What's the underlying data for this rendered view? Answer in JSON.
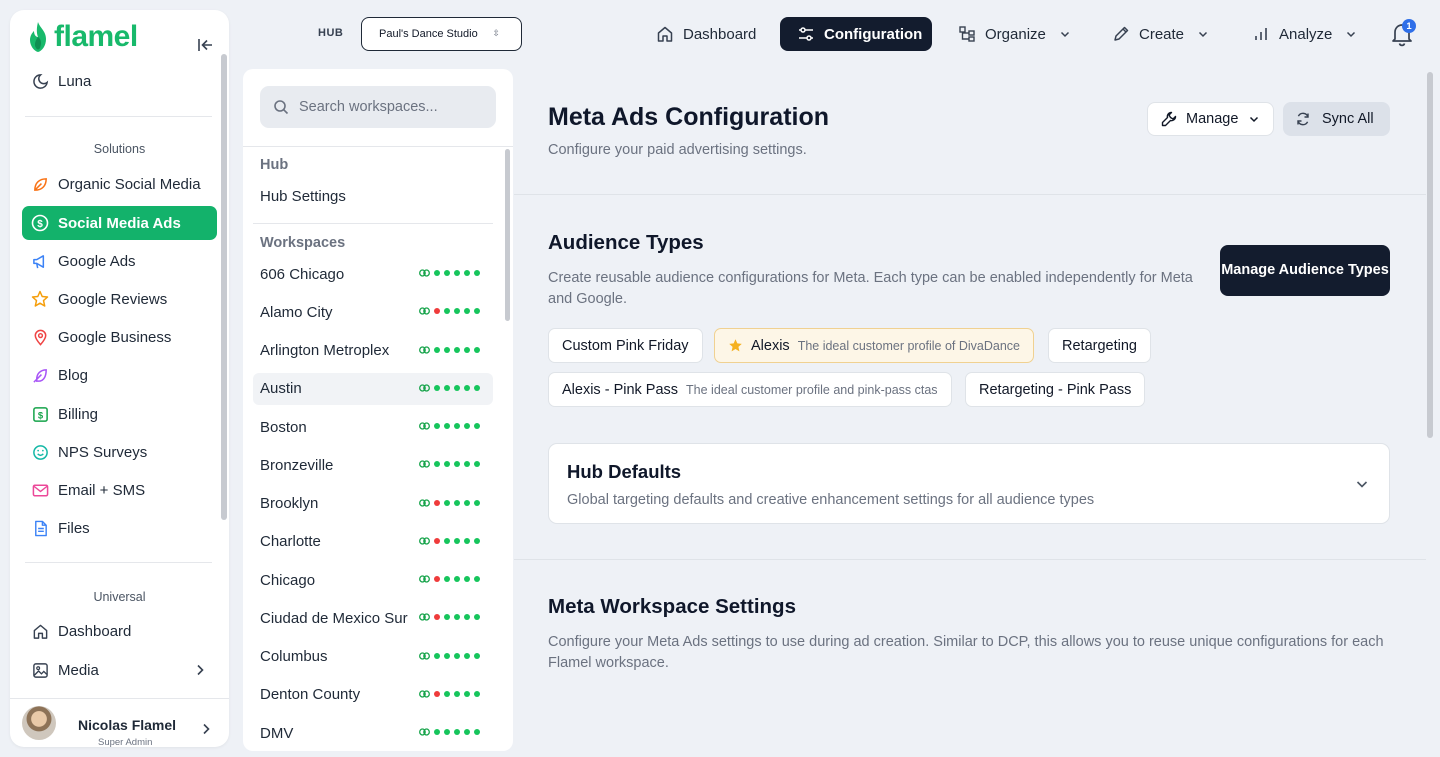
{
  "app": {
    "logo_text": "flamel",
    "brand_color": "#13b26b",
    "dark_color": "#131c2e"
  },
  "sidebar": {
    "top_item": {
      "label": "Luna",
      "icon": "moon-icon"
    },
    "solutions_label": "Solutions",
    "solutions": [
      {
        "label": "Organic Social Media",
        "icon": "leaf-icon",
        "active": false
      },
      {
        "label": "Social Media Ads",
        "icon": "dollar-circle-icon",
        "active": true
      },
      {
        "label": "Google Ads",
        "icon": "megaphone-icon",
        "active": false
      },
      {
        "label": "Google Reviews",
        "icon": "star-icon",
        "active": false
      },
      {
        "label": "Google Business",
        "icon": "map-pin-icon",
        "active": false
      },
      {
        "label": "Blog",
        "icon": "feather-icon",
        "active": false
      },
      {
        "label": "Billing",
        "icon": "dollar-square-icon",
        "active": false
      },
      {
        "label": "NPS Surveys",
        "icon": "smiley-icon",
        "active": false
      },
      {
        "label": "Email + SMS",
        "icon": "mail-icon",
        "active": false
      },
      {
        "label": "Files",
        "icon": "file-icon",
        "active": false
      }
    ],
    "universal_label": "Universal",
    "universal": [
      {
        "label": "Dashboard",
        "icon": "home-icon"
      },
      {
        "label": "Media",
        "icon": "image-icon"
      }
    ],
    "user": {
      "name": "Nicolas Flamel",
      "role": "Super Admin"
    }
  },
  "topbar": {
    "hub_label": "HUB",
    "hub_value": "Paul's Dance Studio",
    "nav": [
      {
        "label": "Dashboard",
        "icon": "home-icon",
        "active": false,
        "dropdown": false
      },
      {
        "label": "Configuration",
        "icon": "sliders-icon",
        "active": true,
        "dropdown": false
      },
      {
        "label": "Organize",
        "icon": "hierarchy-icon",
        "active": false,
        "dropdown": true
      },
      {
        "label": "Create",
        "icon": "pencil-icon",
        "active": false,
        "dropdown": true
      },
      {
        "label": "Analyze",
        "icon": "bar-chart-icon",
        "active": false,
        "dropdown": true
      }
    ],
    "notifications_count": "1"
  },
  "workspaces": {
    "search_placeholder": "Search workspaces...",
    "hub_header": "Hub",
    "hub_settings": "Hub Settings",
    "workspaces_header": "Workspaces",
    "items": [
      {
        "name": "606 Chicago",
        "status": [
          "green",
          "green",
          "green",
          "green",
          "green"
        ],
        "selected": false
      },
      {
        "name": "Alamo City",
        "status": [
          "red",
          "green",
          "green",
          "green",
          "green"
        ],
        "selected": false
      },
      {
        "name": "Arlington Metroplex",
        "status": [
          "green",
          "green",
          "green",
          "green",
          "green"
        ],
        "selected": false
      },
      {
        "name": "Austin",
        "status": [
          "green",
          "green",
          "green",
          "green",
          "green"
        ],
        "selected": true
      },
      {
        "name": "Boston",
        "status": [
          "green",
          "green",
          "green",
          "green",
          "green"
        ],
        "selected": false
      },
      {
        "name": "Bronzeville",
        "status": [
          "green",
          "green",
          "green",
          "green",
          "green"
        ],
        "selected": false
      },
      {
        "name": "Brooklyn",
        "status": [
          "red",
          "green",
          "green",
          "green",
          "green"
        ],
        "selected": false
      },
      {
        "name": "Charlotte",
        "status": [
          "red",
          "green",
          "green",
          "green",
          "green"
        ],
        "selected": false
      },
      {
        "name": "Chicago",
        "status": [
          "red",
          "green",
          "green",
          "green",
          "green"
        ],
        "selected": false
      },
      {
        "name": "Ciudad de Mexico Sur",
        "status": [
          "red",
          "green",
          "green",
          "green",
          "green"
        ],
        "selected": false
      },
      {
        "name": "Columbus",
        "status": [
          "green",
          "green",
          "green",
          "green",
          "green"
        ],
        "selected": false
      },
      {
        "name": "Denton County",
        "status": [
          "red",
          "green",
          "green",
          "green",
          "green"
        ],
        "selected": false
      },
      {
        "name": "DMV",
        "status": [
          "green",
          "green",
          "green",
          "green",
          "green"
        ],
        "selected": false
      }
    ],
    "status_colors": {
      "green": "#16c55c",
      "red": "#ef3b3b",
      "link": "#16a34a"
    }
  },
  "main": {
    "title": "Meta Ads Configuration",
    "subtitle": "Configure your paid advertising settings.",
    "manage_label": "Manage",
    "sync_label": "Sync All",
    "audience": {
      "title": "Audience Types",
      "description": "Create reusable audience configurations for Meta. Each type can be enabled independently for Meta and Google.",
      "manage_button": "Manage Audience Types",
      "chips": [
        {
          "label": "Custom Pink Friday",
          "desc": "",
          "starred": false
        },
        {
          "label": "Alexis",
          "desc": "The ideal customer profile of DivaDance",
          "starred": true
        },
        {
          "label": "Retargeting",
          "desc": "",
          "starred": false
        },
        {
          "label": "Alexis - Pink Pass",
          "desc": "The ideal customer profile and pink-pass ctas",
          "starred": false
        },
        {
          "label": "Retargeting - Pink Pass",
          "desc": "",
          "starred": false
        }
      ]
    },
    "hub_defaults": {
      "title": "Hub Defaults",
      "description": "Global targeting defaults and creative enhancement settings for all audience types"
    },
    "workspace_settings": {
      "title": "Meta Workspace Settings",
      "description": "Configure your Meta Ads settings to use during ad creation. Similar to DCP, this allows you to reuse unique configurations for each Flamel workspace."
    }
  }
}
